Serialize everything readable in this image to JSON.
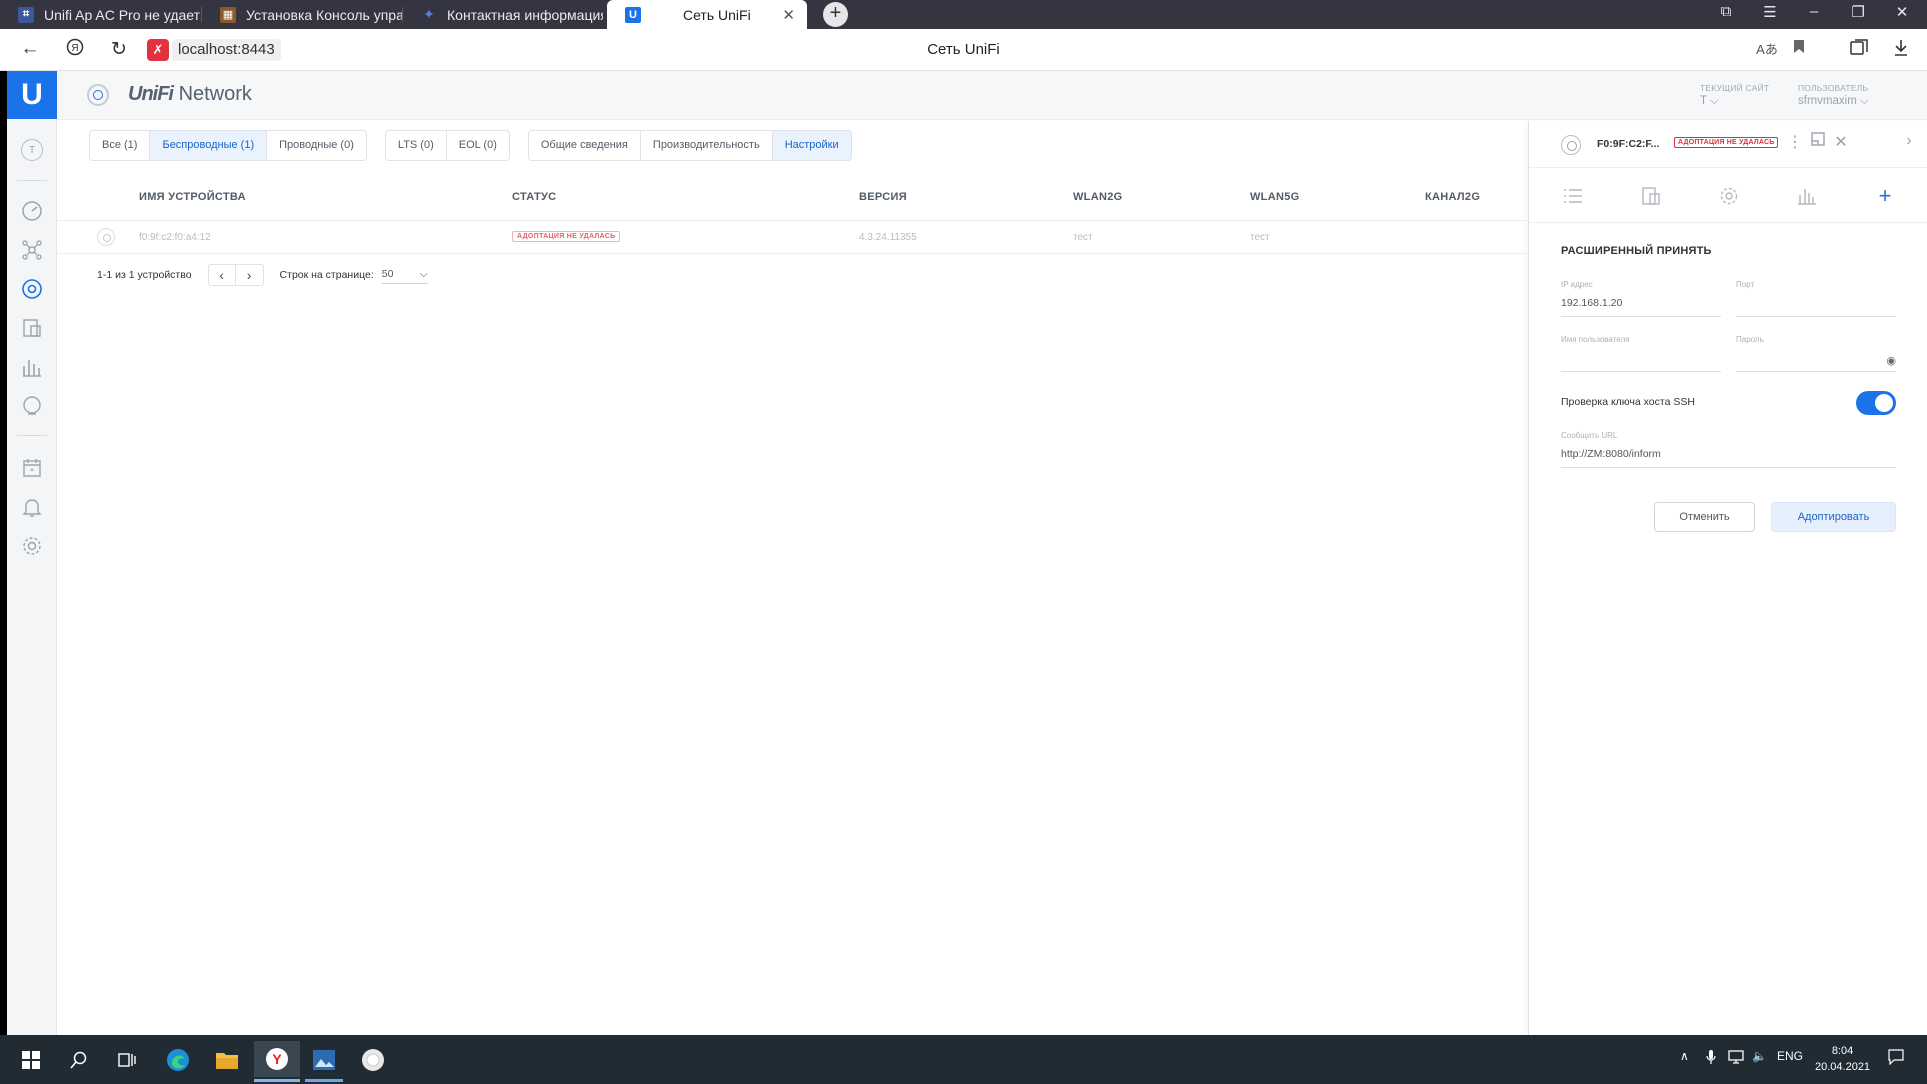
{
  "browser": {
    "tabs": [
      {
        "label": "Unifi Ap AC Pro не удаетс",
        "icon": "forum-icon",
        "color": "#3b5998"
      },
      {
        "label": "Установка Консоль управ",
        "icon": "site-icon",
        "color": "#8a5a2b"
      },
      {
        "label": "Контактная информация",
        "icon": "star-logo-icon",
        "color": "#2a3e7a"
      },
      {
        "label": "Сеть UniFi",
        "icon": "unifi-icon",
        "color": "#1a73e8"
      }
    ],
    "url": "localhost:8443",
    "page_title": "Сеть UniFi"
  },
  "app": {
    "brand_prefix": "UniFi",
    "brand_suffix": "Network",
    "site_letter": "T",
    "current_site_caption": "ТЕКУЩИЙ САЙТ",
    "current_site_value": "T",
    "user_caption": "ПОЛЬЗОВАТЕЛЬ",
    "user_value": "sfrnvmaxim"
  },
  "filters": {
    "group1": [
      "Все (1)",
      "Беспроводные (1)",
      "Проводные (0)"
    ],
    "group2": [
      "LTS (0)",
      "EOL (0)"
    ],
    "group3": [
      "Общие сведения",
      "Производительность",
      "Настройки"
    ]
  },
  "table": {
    "columns": [
      "ИМЯ УСТРОЙСТВА",
      "СТАТУС",
      "ВЕРСИЯ",
      "WLAN2G",
      "WLAN5G",
      "КАНАЛ2G"
    ],
    "rows": [
      {
        "name": "f0:9f:c2:f0:a4:12",
        "status": "АДОПТАЦИЯ НЕ УДАЛАСЬ",
        "version": "4.3.24.11355",
        "wlan2g": "тест",
        "wlan5g": "тест"
      }
    ],
    "summary": "1-1 из 1 устройство",
    "per_page_label": "Строк на странице:",
    "per_page_value": "50"
  },
  "panel": {
    "device_name": "F0:9F:C2:F...",
    "status_badge": "АДОПТАЦИЯ НЕ УДАЛАСЬ",
    "section_title": "РАСШИРЕННЫЙ ПРИНЯТЬ",
    "ip_label": "IP адрес",
    "ip_value": "192.168.1.20",
    "port_label": "Порт",
    "port_value": "",
    "user_label": "Имя пользователя",
    "user_value": "",
    "password_label": "Пароль",
    "password_value": "",
    "ssh_check_label": "Проверка ключа хоста SSH",
    "ssh_check_on": true,
    "inform_label": "Сообщить URL",
    "inform_value": "http://ZM:8080/inform",
    "cancel_label": "Отменить",
    "adopt_label": "Адоптировать"
  },
  "taskbar": {
    "language": "ENG",
    "time": "8:04",
    "date": "20.04.2021"
  },
  "colors": {
    "accent": "#1a73e8",
    "error": "#d7333f",
    "taskbar": "#202b33"
  }
}
